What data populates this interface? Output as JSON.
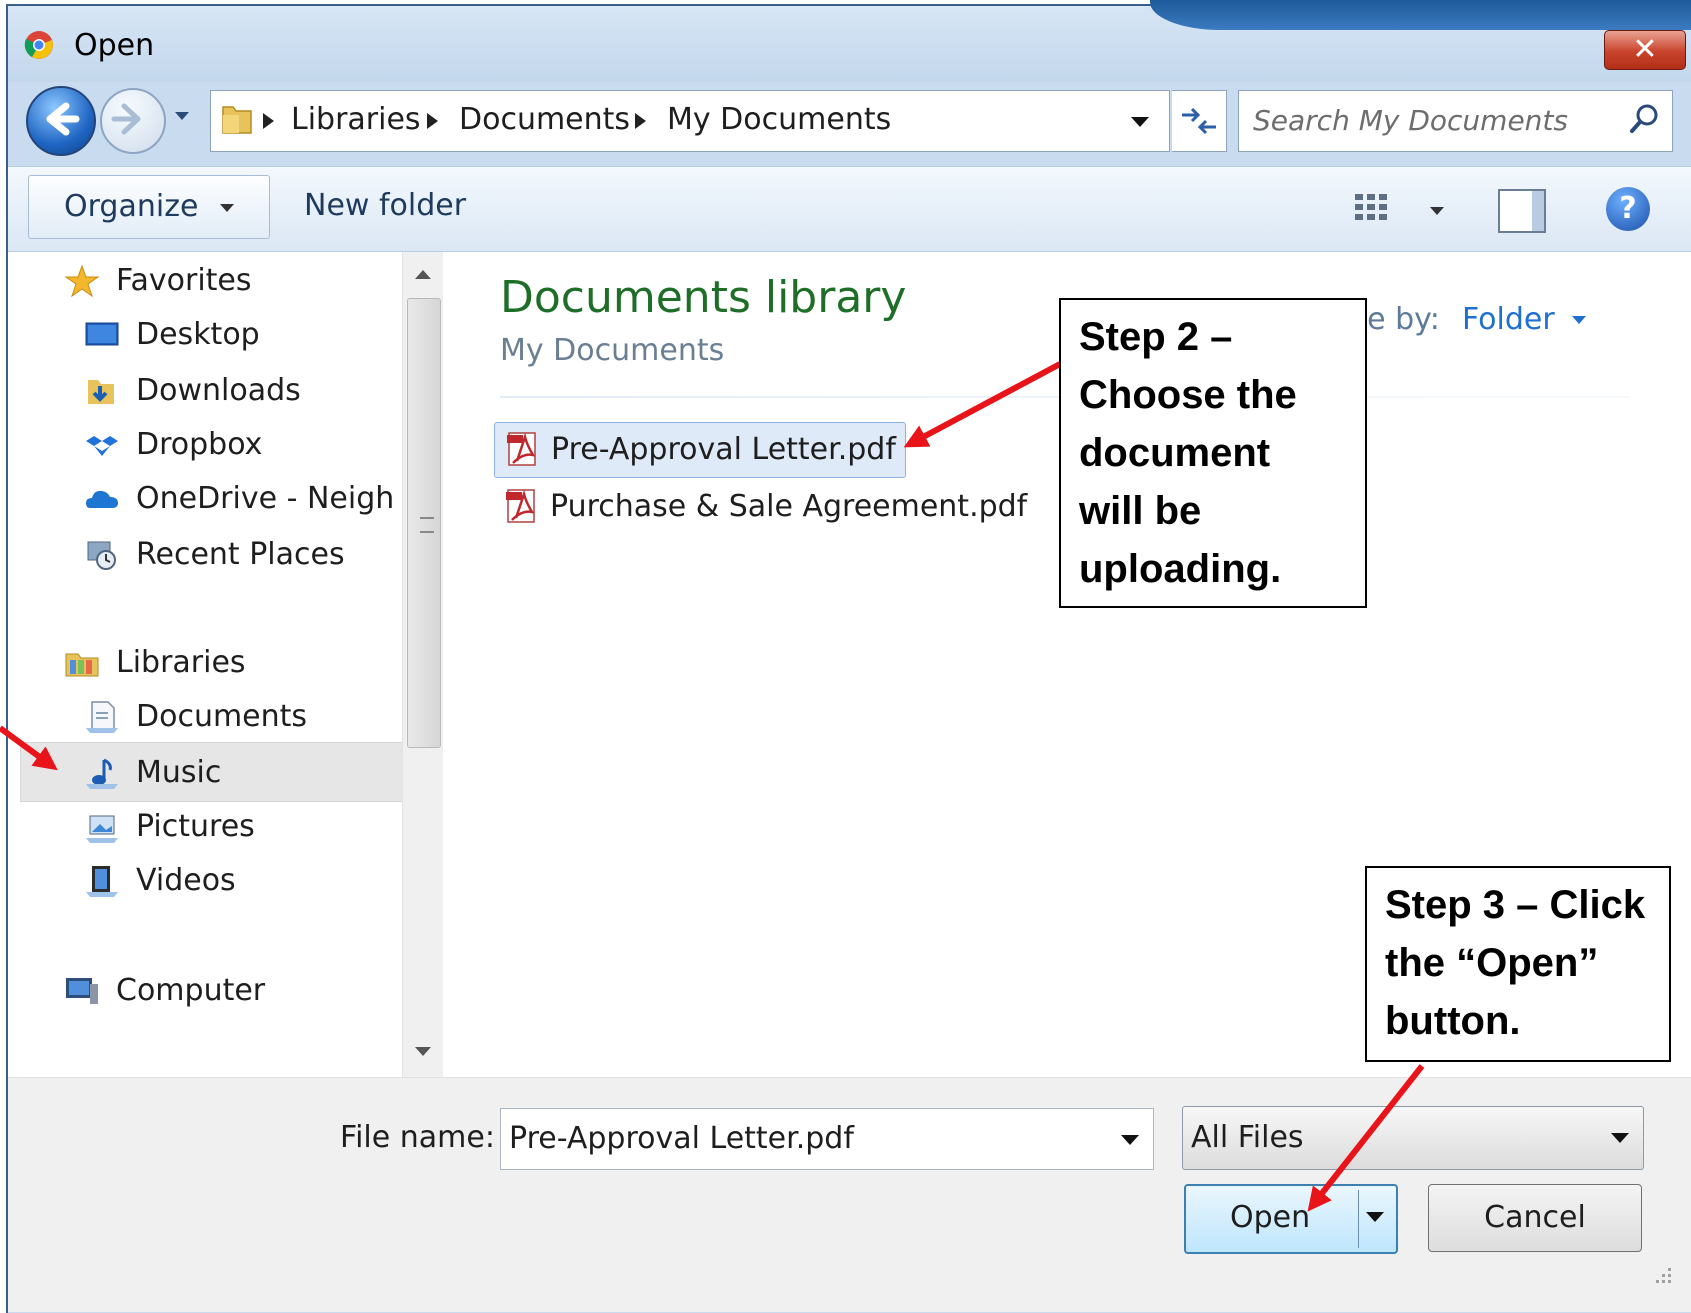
{
  "window": {
    "title": "Open",
    "close_label": "✕"
  },
  "address": {
    "crumbs": [
      "Libraries",
      "Documents",
      "My Documents"
    ]
  },
  "search": {
    "placeholder": "Search My Documents"
  },
  "toolbar": {
    "organize_label": "Organize",
    "new_folder_label": "New folder",
    "help_label": "?"
  },
  "nav": {
    "items": [
      {
        "label": "Favorites",
        "icon": "star-icon"
      },
      {
        "label": "Desktop",
        "icon": "desktop-icon"
      },
      {
        "label": "Downloads",
        "icon": "downloads-icon"
      },
      {
        "label": "Dropbox",
        "icon": "dropbox-icon"
      },
      {
        "label": "OneDrive - Neigh",
        "icon": "onedrive-icon"
      },
      {
        "label": "Recent Places",
        "icon": "recent-places-icon"
      },
      {
        "label": "Libraries",
        "icon": "libraries-icon"
      },
      {
        "label": "Documents",
        "icon": "documents-icon"
      },
      {
        "label": "Music",
        "icon": "music-icon"
      },
      {
        "label": "Pictures",
        "icon": "pictures-icon"
      },
      {
        "label": "Videos",
        "icon": "videos-icon"
      },
      {
        "label": "Computer",
        "icon": "computer-icon"
      }
    ],
    "selected": "Documents"
  },
  "content": {
    "library_title": "Documents library",
    "library_subtitle": "My Documents",
    "arrange_label": "Arrange by:",
    "arrange_value": "Folder",
    "files": [
      {
        "name": "Pre-Approval Letter.pdf",
        "icon": "pdf-icon",
        "selected": true
      },
      {
        "name": "Purchase & Sale Agreement.pdf",
        "icon": "pdf-icon",
        "selected": false
      }
    ]
  },
  "bottom": {
    "file_name_label": "File name:",
    "file_name_value": "Pre-Approval Letter.pdf",
    "file_type_value": "All Files",
    "open_label": "Open",
    "cancel_label": "Cancel"
  },
  "annotations": {
    "step2": "Step 2 –\nChoose the\ndocument\nwill be\nuploading.",
    "step3": "Step 3 – Click\nthe “Open”\nbutton.",
    "arrow_color": "#e8141a"
  },
  "colors": {
    "library_title": "#1e6e28",
    "link_blue": "#1f6fcf"
  }
}
